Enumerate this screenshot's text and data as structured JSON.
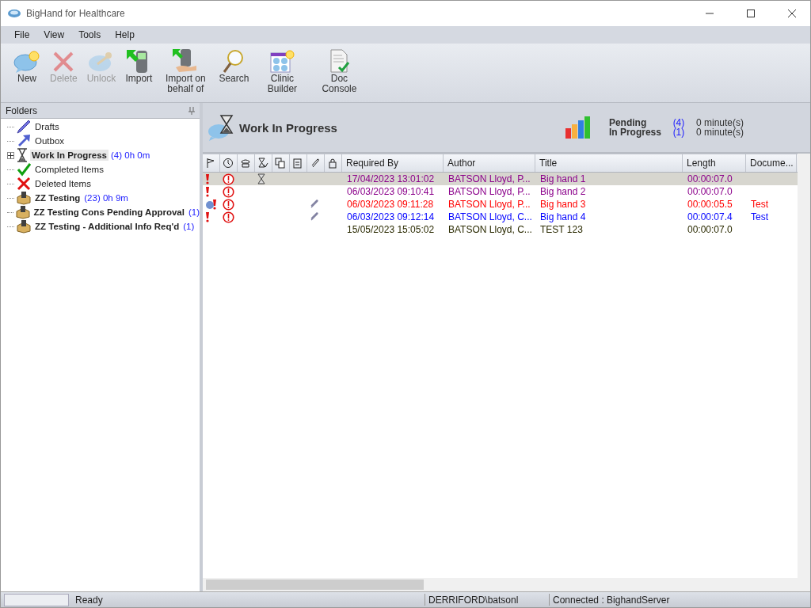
{
  "window": {
    "title": "BigHand for Healthcare"
  },
  "menu": [
    "File",
    "View",
    "Tools",
    "Help"
  ],
  "toolbar": [
    {
      "label": "New",
      "kind": "new",
      "disabled": false
    },
    {
      "label": "Delete",
      "kind": "delete",
      "disabled": true
    },
    {
      "label": "Unlock",
      "kind": "unlock",
      "disabled": true
    },
    {
      "label": "Import",
      "kind": "import",
      "disabled": false
    },
    {
      "label": "Import on behalf of",
      "kind": "import_behalf",
      "disabled": false
    },
    {
      "label": "Search",
      "kind": "search",
      "disabled": false
    },
    {
      "label": "Clinic Builder",
      "kind": "clinic",
      "disabled": false
    },
    {
      "label": "Doc Console",
      "kind": "console",
      "disabled": false
    }
  ],
  "folders": {
    "title": "Folders",
    "items": [
      {
        "label": "Drafts",
        "kind": "drafts",
        "bold": false,
        "expandable": false,
        "selected": false
      },
      {
        "label": "Outbox",
        "kind": "outbox",
        "bold": false,
        "expandable": false,
        "selected": false
      },
      {
        "label": "Work In Progress",
        "count": "(4) 0h 0m",
        "kind": "progress",
        "bold": true,
        "expandable": true,
        "selected": true
      },
      {
        "label": "Completed Items",
        "kind": "completed",
        "bold": false,
        "expandable": false,
        "selected": false
      },
      {
        "label": "Deleted Items",
        "kind": "deleted",
        "bold": false,
        "expandable": false,
        "selected": false
      },
      {
        "label": "ZZ Testing",
        "count": "(23) 0h 9m",
        "kind": "group",
        "bold": true,
        "expandable": false,
        "selected": false
      },
      {
        "label": "ZZ Testing Cons Pending Approval",
        "count": "(1)",
        "kind": "group",
        "bold": true,
        "expandable": false,
        "selected": false
      },
      {
        "label": "ZZ Testing - Additional Info Req'd",
        "count": "(1)",
        "kind": "group",
        "bold": true,
        "expandable": false,
        "selected": false
      }
    ]
  },
  "header": {
    "title": "Work In Progress",
    "stats": [
      {
        "label": "Pending",
        "count": "(4)",
        "time": "0 minute(s)"
      },
      {
        "label": "In Progress",
        "count": "(1)",
        "time": "0 minute(s)"
      }
    ]
  },
  "table": {
    "columns": [
      "Required By",
      "Author",
      "Title",
      "Length",
      "Docume..."
    ],
    "rows": [
      {
        "color": "#8b008b",
        "selected": true,
        "kind": "urgent",
        "overdue": true,
        "in_progress": true,
        "attachment": false,
        "required_by": "17/04/2023 13:01:02",
        "author": "BATSON Lloyd, P...",
        "title": "Big hand 1",
        "length": "00:00:07.0"
      },
      {
        "color": "#8b008b",
        "selected": false,
        "kind": "urgent",
        "overdue": true,
        "in_progress": false,
        "attachment": false,
        "required_by": "06/03/2023 09:10:41",
        "author": "BATSON Lloyd, P...",
        "title": "Big hand 2",
        "length": "00:00:07.0"
      },
      {
        "color": "#ff0000",
        "selected": false,
        "kind": "urgent_note",
        "overdue": true,
        "in_progress": false,
        "attachment": true,
        "required_by": "06/03/2023 09:11:28",
        "author": "BATSON Lloyd, P...",
        "title": "Big hand 3",
        "length": "00:00:05.5",
        "document": "Test"
      },
      {
        "color": "#0000ff",
        "selected": false,
        "kind": "urgent",
        "overdue": true,
        "in_progress": false,
        "attachment": true,
        "required_by": "06/03/2023 09:12:14",
        "author": "BATSON Lloyd, C...",
        "title": "Big hand 4",
        "length": "00:00:07.4",
        "document": "Test"
      },
      {
        "color": "#2a2a00",
        "selected": false,
        "kind": "plain",
        "overdue": false,
        "in_progress": false,
        "attachment": false,
        "required_by": "15/05/2023 15:05:02",
        "author": "BATSON Lloyd, C...",
        "title": "TEST 123",
        "length": "00:00:07.0"
      }
    ]
  },
  "status_bar": {
    "status": "Ready",
    "user": "DERRIFORD\\batsonl",
    "connection": "Connected : BighandServer"
  }
}
